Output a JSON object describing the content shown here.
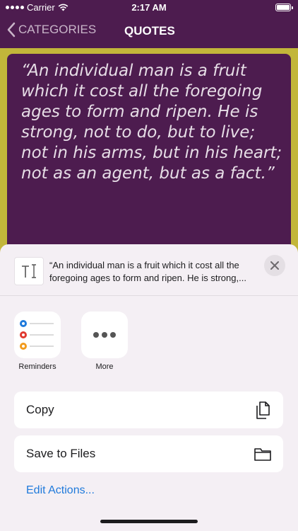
{
  "status_bar": {
    "carrier": "Carrier",
    "time": "2:17 AM"
  },
  "nav": {
    "back_label": "CATEGORIES",
    "title": "QUOTES"
  },
  "quote": {
    "text": "“An individual man is a fruit which it cost all the foregoing ages to form and ripen. He is strong, not to do, but to live; not in his arms, but in his heart; not as an agent, but as a fact.”"
  },
  "share_sheet": {
    "preview_text": "“An individual man is a fruit which it cost all the foregoing ages to form and ripen. He is strong,...",
    "apps": [
      {
        "label": "Reminders",
        "icon": "reminders-icon"
      },
      {
        "label": "More",
        "icon": "more-icon"
      }
    ],
    "actions": [
      {
        "label": "Copy",
        "icon": "copy-icon"
      },
      {
        "label": "Save to Files",
        "icon": "folder-icon"
      }
    ],
    "edit_actions_label": "Edit Actions..."
  },
  "colors": {
    "nav_background": "#4d1c4f",
    "backdrop": "#c2b63a",
    "accent_link": "#1f7adb"
  }
}
